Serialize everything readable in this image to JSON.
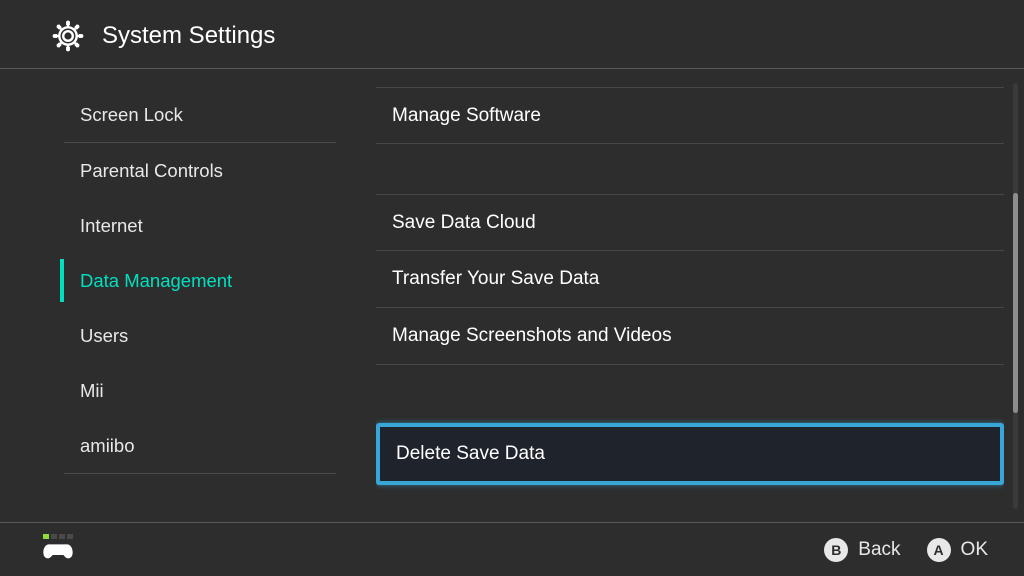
{
  "header": {
    "title": "System Settings"
  },
  "sidebar": {
    "items": [
      {
        "label": "Screen Lock",
        "selected": false,
        "divider_after": true
      },
      {
        "label": "Parental Controls",
        "selected": false,
        "divider_after": false
      },
      {
        "label": "Internet",
        "selected": false,
        "divider_after": false
      },
      {
        "label": "Data Management",
        "selected": true,
        "divider_after": false
      },
      {
        "label": "Users",
        "selected": false,
        "divider_after": false
      },
      {
        "label": "Mii",
        "selected": false,
        "divider_after": false
      },
      {
        "label": "amiibo",
        "selected": false,
        "divider_after": false
      }
    ]
  },
  "main": {
    "items": [
      {
        "label": "Manage Software",
        "highlight": false,
        "gap_after": "normal"
      },
      {
        "label": "Save Data Cloud",
        "highlight": false,
        "gap_after": "none"
      },
      {
        "label": "Transfer Your Save Data",
        "highlight": false,
        "gap_after": "none"
      },
      {
        "label": "Manage Screenshots and Videos",
        "highlight": false,
        "gap_after": "large"
      },
      {
        "label": "Delete Save Data",
        "highlight": true,
        "gap_after": "none"
      }
    ]
  },
  "footer": {
    "buttons": [
      {
        "glyph": "B",
        "label": "Back"
      },
      {
        "glyph": "A",
        "label": "OK"
      }
    ]
  }
}
